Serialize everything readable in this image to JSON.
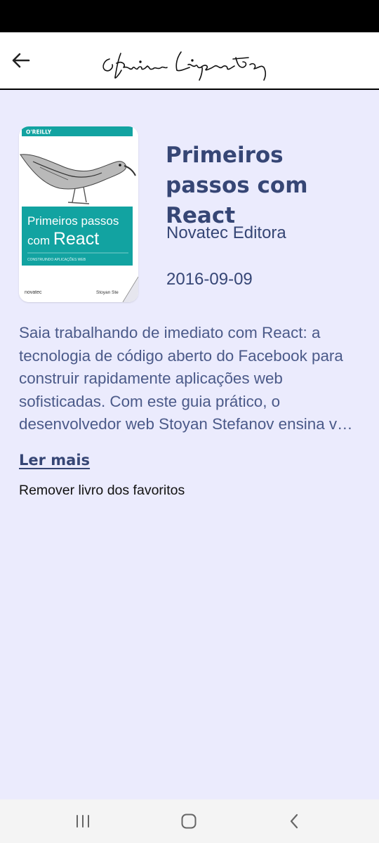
{
  "header": {
    "back_icon": "arrow-left-icon",
    "logo_text": "Clarice Lispector"
  },
  "book": {
    "title": "Primeiros passos com React",
    "publisher": "Novatec Editora",
    "date": "2016-09-09",
    "description": "Saia trabalhando de imediato com React: a tecnologia de código aberto do Facebook para construir rapidamente aplicações web sofisticadas. Com este guia prático, o desenvolvedor web Stoyan Stefanov ensina v…",
    "cover": {
      "publisher_mark": "O'REILLY",
      "title_line1": "Primeiros passos",
      "title_line2_prefix": "com ",
      "title_line2_strong": "React",
      "subtitle": "CONSTRUINDO APLICAÇÕES WEB",
      "imprint": "novatec",
      "author": "Stoyan Ste"
    }
  },
  "actions": {
    "read_more": "Ler mais",
    "remove_favorite": "Remover livro dos favoritos"
  },
  "navbar": {
    "icons": [
      "recent-apps-icon",
      "home-icon",
      "back-icon"
    ]
  },
  "colors": {
    "background": "#ebebfd",
    "primary_text": "#364675",
    "body_text": "#4b5a89",
    "cover_teal": "#12a3a1"
  }
}
